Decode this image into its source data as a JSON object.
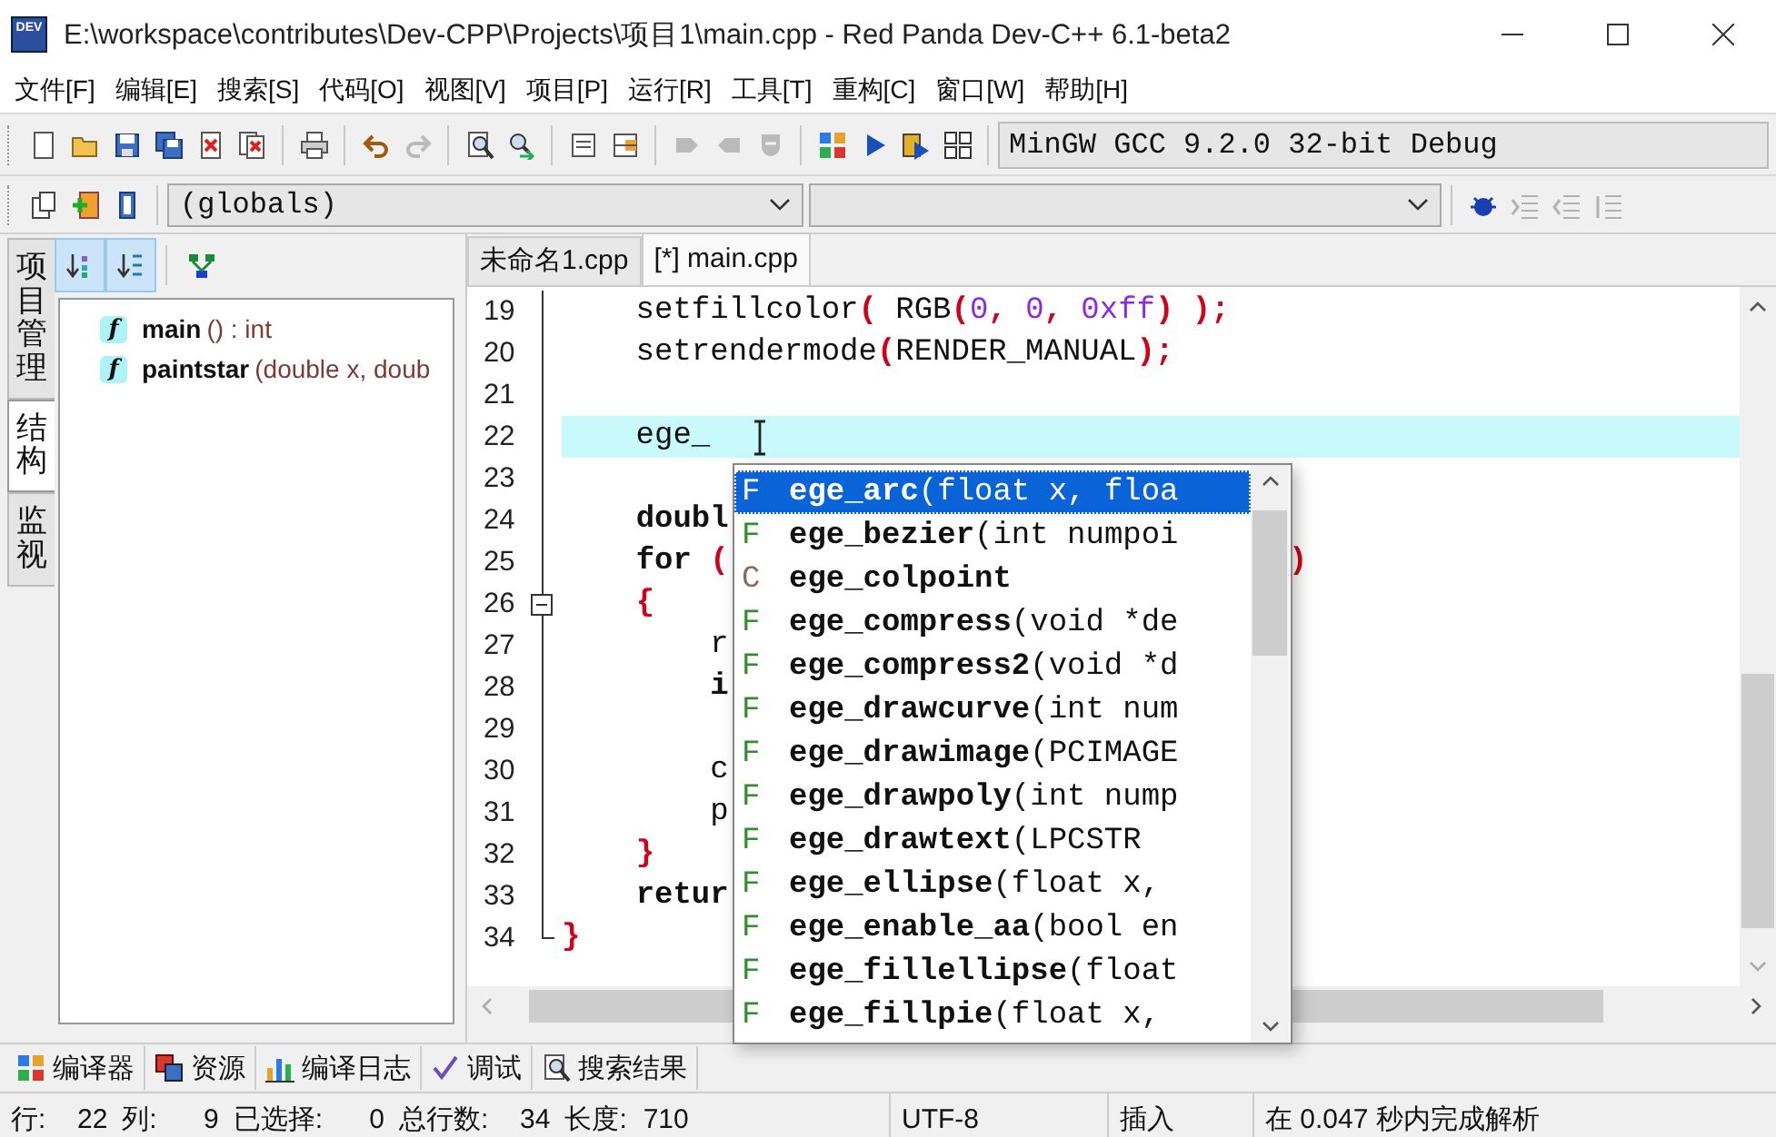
{
  "window": {
    "icon_label": "DEV",
    "title": "E:\\workspace\\contributes\\Dev-CPP\\Projects\\项目1\\main.cpp - Red Panda Dev-C++ 6.1-beta2"
  },
  "menu": [
    "文件[F]",
    "编辑[E]",
    "搜索[S]",
    "代码[O]",
    "视图[V]",
    "项目[P]",
    "运行[R]",
    "工具[T]",
    "重构[C]",
    "窗口[W]",
    "帮助[H]"
  ],
  "toolbar": {
    "buttons": [
      {
        "disabled": false
      },
      {
        "disabled": false
      },
      {
        "disabled": false
      },
      {
        "disabled": false
      },
      {
        "disabled": false
      },
      {
        "disabled": false
      },
      {
        "disabled": false
      },
      {
        "disabled": false
      },
      {
        "disabled": true
      },
      {
        "disabled": false
      },
      {
        "disabled": false
      },
      {
        "disabled": false
      },
      {
        "disabled": false
      },
      {
        "disabled": true
      },
      {
        "disabled": true
      },
      {
        "disabled": true
      },
      {
        "disabled": false
      },
      {
        "disabled": false
      },
      {
        "disabled": false
      },
      {
        "disabled": false
      }
    ],
    "compiler": "MinGW GCC 9.2.0 32-bit Debug"
  },
  "navigation_bar": {
    "buttons": [
      {
        "disabled": false
      },
      {
        "disabled": false
      },
      {
        "disabled": false
      }
    ],
    "scope": "(globals)",
    "tools": [
      {
        "disabled": false
      },
      {
        "disabled": true
      },
      {
        "disabled": true
      },
      {
        "disabled": true
      }
    ]
  },
  "side_tabs": [
    {
      "label": "项目管理",
      "selected": false
    },
    {
      "label": "结构",
      "selected": true
    },
    {
      "label": "监视",
      "selected": false
    }
  ],
  "class_browser": {
    "buttons": [
      {
        "pressed": true
      },
      {
        "pressed": true
      },
      {
        "pressed": false
      }
    ],
    "items": [
      {
        "icon_letter": "f",
        "name": "main",
        "detail": "() :  int"
      },
      {
        "icon_letter": "f",
        "name": "paintstar",
        "detail": "(double x, doub"
      }
    ]
  },
  "editor_tabs": [
    {
      "label": "未命名1.cpp",
      "selected": false
    },
    {
      "label": "[*] main.cpp",
      "selected": true
    }
  ],
  "code_lines": [
    {
      "number": "19",
      "fold_start": false,
      "current": false,
      "text": "    setfillcolor( RGB(0, 0, 0xff) );"
    },
    {
      "number": "20",
      "fold_start": false,
      "current": false,
      "text": "    setrendermode(RENDER_MANUAL);"
    },
    {
      "number": "21",
      "fold_start": false,
      "current": false
    },
    {
      "number": "22",
      "fold_start": false,
      "current": true,
      "text": "    ege_"
    },
    {
      "number": "23",
      "fold_start": false,
      "current": false
    },
    {
      "number": "24",
      "fold_start": false,
      "current": false,
      "text": "    **doubl**"
    },
    {
      "number": "25",
      "fold_start": false,
      "current": false,
      "text": "    **for** (",
      "after_popup": ")"
    },
    {
      "number": "26",
      "fold_start": true,
      "current": false,
      "text": "    {"
    },
    {
      "number": "27",
      "fold_start": false,
      "current": false,
      "text": "        r"
    },
    {
      "number": "28",
      "fold_start": false,
      "current": false,
      "text": "        **i**"
    },
    {
      "number": "29",
      "fold_start": false,
      "current": false
    },
    {
      "number": "30",
      "fold_start": false,
      "current": false,
      "text": "        c"
    },
    {
      "number": "31",
      "fold_start": false,
      "current": false,
      "text": "        p"
    },
    {
      "number": "32",
      "fold_start": false,
      "current": false,
      "text": "    }"
    },
    {
      "number": "33",
      "fold_start": false,
      "current": false,
      "text": "    **retur**"
    },
    {
      "number": "34",
      "fold_start": false,
      "current": false,
      "text": "}"
    }
  ],
  "completion": [
    {
      "type": "F",
      "name": "ege_arc",
      "params": "(float x, floa",
      "selected": true
    },
    {
      "type": "F",
      "name": "ege_bezier",
      "params": "(int numpoi",
      "selected": false
    },
    {
      "type": "C",
      "name": "ege_colpoint",
      "selected": false
    },
    {
      "type": "F",
      "name": "ege_compress",
      "params": "(void *de",
      "selected": false
    },
    {
      "type": "F",
      "name": "ege_compress2",
      "params": "(void *d",
      "selected": false
    },
    {
      "type": "F",
      "name": "ege_drawcurve",
      "params": "(int num",
      "selected": false
    },
    {
      "type": "F",
      "name": "ege_drawimage",
      "params": "(PCIMAGE",
      "selected": false
    },
    {
      "type": "F",
      "name": "ege_drawpoly",
      "params": "(int nump",
      "selected": false
    },
    {
      "type": "F",
      "name": "ege_drawtext",
      "params": "(LPCSTR",
      "selected": false
    },
    {
      "type": "F",
      "name": "ege_ellipse",
      "params": "(float x,",
      "selected": false
    },
    {
      "type": "F",
      "name": "ege_enable_aa",
      "params": "(bool en",
      "selected": false
    },
    {
      "type": "F",
      "name": "ege_fillellipse",
      "params": "(float",
      "selected": false
    },
    {
      "type": "F",
      "name": "ege_fillpie",
      "params": "(float x,",
      "selected": false
    }
  ],
  "bottom_tabs": [
    "编译器",
    "资源",
    "编译日志",
    "调试",
    "搜索结果"
  ],
  "status_bar": {
    "position": [
      {
        "label": "行:",
        "value": "22"
      },
      {
        "label": "列:",
        "value": "9"
      },
      {
        "label": "已选择:",
        "value": "0"
      },
      {
        "label": "总行数:",
        "value": "34"
      },
      {
        "label": "长度:",
        "value": "710"
      }
    ],
    "encoding": "UTF-8",
    "mode": "插入",
    "message": "在 0.047 秒内完成解析"
  }
}
